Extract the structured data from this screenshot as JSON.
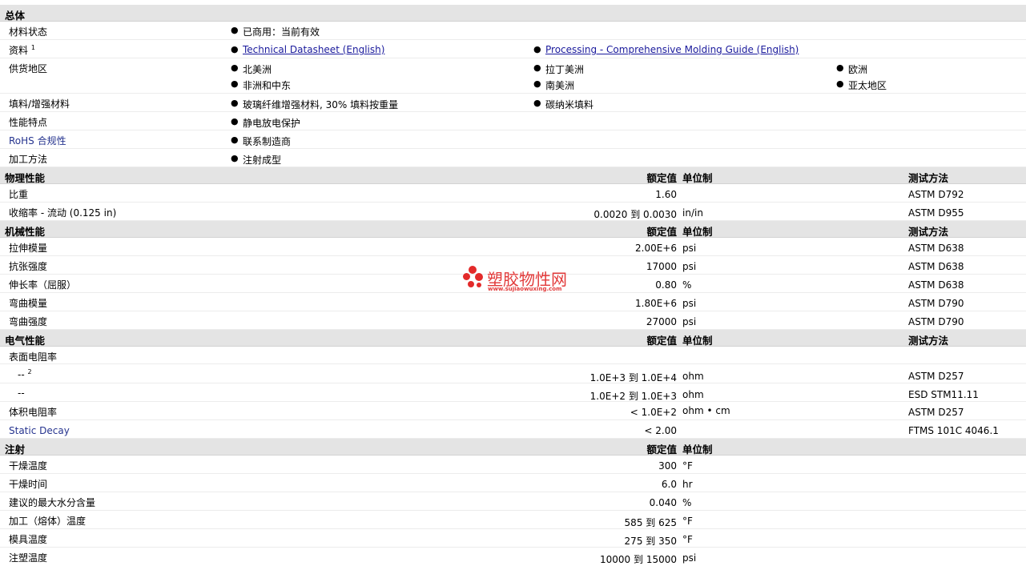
{
  "general": {
    "title": "总体",
    "material_status": {
      "label": "材料状态",
      "value": "已商用：当前有效"
    },
    "docs": {
      "label": "资料",
      "note": "1",
      "links": [
        "Technical Datasheet (English)",
        "Processing - Comprehensive Molding Guide (English)"
      ]
    },
    "regions": {
      "label": "供货地区",
      "items": [
        "北美洲",
        "拉丁美洲",
        "欧洲",
        "非洲和中东",
        "南美洲",
        "亚太地区"
      ]
    },
    "fillers": {
      "label": "填料/增强材料",
      "items": [
        "玻璃纤维增强材料, 30% 填料按重量",
        "碳纳米填料"
      ]
    },
    "features": {
      "label": "性能特点",
      "value": "静电放电保护"
    },
    "rohs": {
      "label": "RoHS 合规性",
      "value": "联系制造商"
    },
    "process": {
      "label": "加工方法",
      "value": "注射成型"
    }
  },
  "physical": {
    "title": "物理性能",
    "h_value": "额定值",
    "h_unit": "单位制",
    "h_method": "测试方法",
    "rows": [
      {
        "label": "比重",
        "value": "1.60",
        "unit": "",
        "method": "ASTM D792"
      },
      {
        "label": "收缩率 - 流动 (0.125 in)",
        "value": "0.0020 到 0.0030",
        "unit": "in/in",
        "method": "ASTM D955"
      }
    ]
  },
  "mechanical": {
    "title": "机械性能",
    "h_value": "额定值",
    "h_unit": "单位制",
    "h_method": "测试方法",
    "rows": [
      {
        "label": "拉伸模量",
        "value": "2.00E+6",
        "unit": "psi",
        "method": "ASTM D638"
      },
      {
        "label": "抗张强度",
        "value": "17000",
        "unit": "psi",
        "method": "ASTM D638"
      },
      {
        "label": "伸长率（屈服）",
        "value": "0.80",
        "unit": "%",
        "method": "ASTM D638"
      },
      {
        "label": "弯曲模量",
        "value": "1.80E+6",
        "unit": "psi",
        "method": "ASTM D790"
      },
      {
        "label": "弯曲强度",
        "value": "27000",
        "unit": "psi",
        "method": "ASTM D790"
      }
    ]
  },
  "electrical": {
    "title": "电气性能",
    "h_value": "额定值",
    "h_unit": "单位制",
    "h_method": "测试方法",
    "surface_label": "表面电阻率",
    "sub1": {
      "label": "--",
      "note": "2",
      "value": "1.0E+3 到 1.0E+4",
      "unit": "ohm",
      "method": "ASTM D257"
    },
    "sub2": {
      "label": "--",
      "value": "1.0E+2 到 1.0E+3",
      "unit": "ohm",
      "method": "ESD STM11.11"
    },
    "volume": {
      "label": "体积电阻率",
      "value": "< 1.0E+2",
      "unit": "ohm • cm",
      "method": "ASTM D257"
    },
    "decay": {
      "label": "Static Decay",
      "value": "< 2.00",
      "unit": "",
      "method": "FTMS 101C 4046.1"
    }
  },
  "injection": {
    "title": "注射",
    "h_value": "额定值",
    "h_unit": "单位制",
    "rows": [
      {
        "label": "干燥温度",
        "value": "300",
        "unit": "°F"
      },
      {
        "label": "干燥时间",
        "value": "6.0",
        "unit": "hr"
      },
      {
        "label": "建议的最大水分含量",
        "value": "0.040",
        "unit": "%"
      },
      {
        "label": "加工（熔体）温度",
        "value": "585 到 625",
        "unit": "°F"
      },
      {
        "label": "模具温度",
        "value": "275 到 350",
        "unit": "°F"
      },
      {
        "label": "注塑温度",
        "value": "10000 到 15000",
        "unit": "psi"
      }
    ]
  },
  "watermark": {
    "cn": "塑胶物性网",
    "en": "www.sujiaowuxing.com"
  },
  "colors": {
    "section_bg": "#e4e4e4",
    "link": "#1a1a9c",
    "watermark": "#e32a2a"
  }
}
